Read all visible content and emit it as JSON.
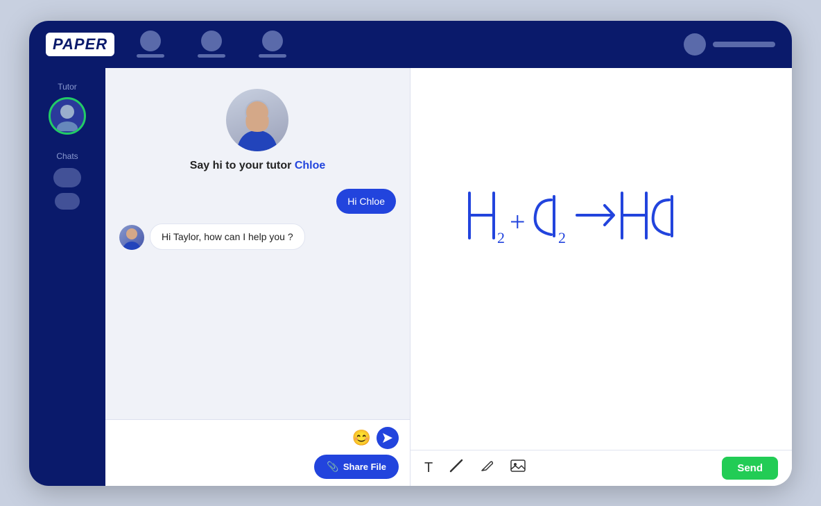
{
  "app": {
    "name": "PAPER"
  },
  "nav": {
    "icons": [
      {
        "label": "nav-item-1"
      },
      {
        "label": "nav-item-2"
      },
      {
        "label": "nav-item-3"
      }
    ],
    "user_name": ""
  },
  "sidebar": {
    "tutor_label": "Tutor",
    "chats_label": "Chats"
  },
  "chat": {
    "greeting": "Say hi to your tutor ",
    "tutor_name": "Chloe",
    "messages": [
      {
        "id": 1,
        "text": "Hi Chloe",
        "sender": "user"
      },
      {
        "id": 2,
        "text": "Hi Taylor, how can I help you ?",
        "sender": "tutor"
      }
    ],
    "input_placeholder": "",
    "emoji_label": "😊",
    "send_label": "➤",
    "share_file_label": "Share File"
  },
  "whiteboard": {
    "formula": "H₂ + Cl₂ → HCl",
    "toolbar": {
      "text_tool": "T",
      "eraser_tool": "/",
      "pen_tool": "✏",
      "image_tool": "🖼",
      "send_label": "Send"
    }
  }
}
